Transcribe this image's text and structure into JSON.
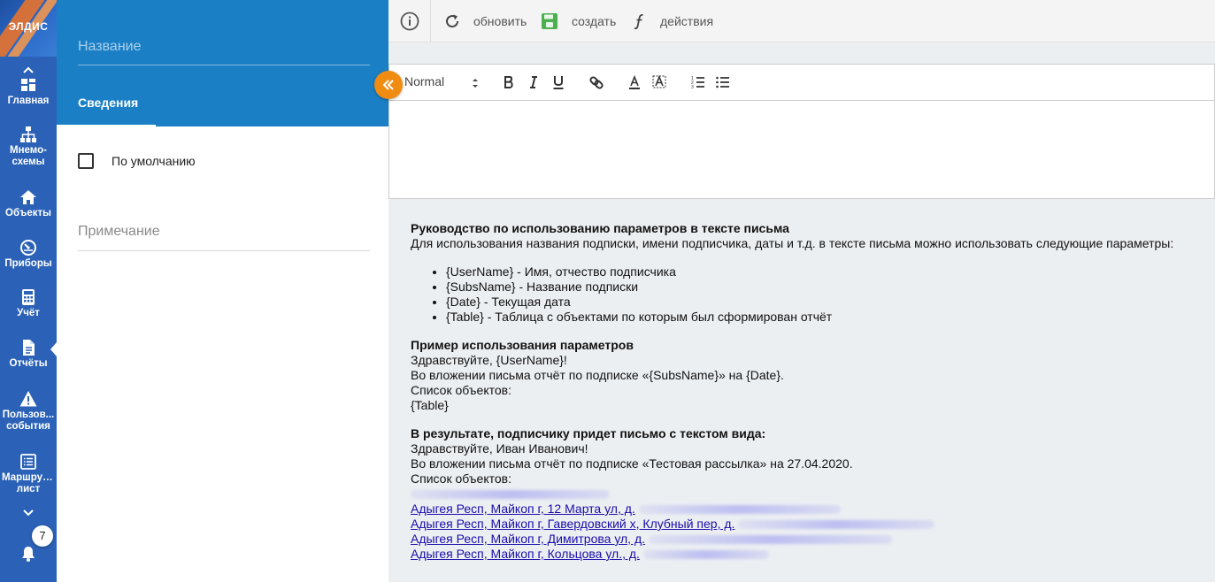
{
  "brand": {
    "logo_text": "ЭЛДИС"
  },
  "nav": {
    "items": [
      {
        "label": "Главная",
        "icon": "dashboard-icon"
      },
      {
        "label": "Мнемо-схемы",
        "label_line1": "Мнемо-",
        "label_line2": "схемы",
        "icon": "sitemap-icon"
      },
      {
        "label": "Объекты",
        "icon": "home-icon"
      },
      {
        "label": "Приборы",
        "icon": "gauge-icon"
      },
      {
        "label": "Учёт",
        "icon": "calculator-icon"
      },
      {
        "label": "Отчёты",
        "icon": "report-icon",
        "active": true
      },
      {
        "label_line1": "Пользов...",
        "label_line2": "события",
        "icon": "warning-icon"
      },
      {
        "label_line1": "Маршрут...",
        "label_line2": "лист",
        "icon": "list-icon"
      }
    ],
    "notifications_count": "7"
  },
  "form": {
    "title_placeholder": "Название",
    "tab_label": "Сведения",
    "default_checkbox_label": "По умолчанию",
    "default_checked": false,
    "note_placeholder": "Примечание"
  },
  "toolbar": {
    "refresh_label": "обновить",
    "create_label": "создать",
    "actions_label": "действия"
  },
  "editor": {
    "format_value": "Normal",
    "body_text": ""
  },
  "guide": {
    "heading": "Руководство по использованию параметров в тексте письма",
    "intro": "Для использования названия подписки, имени подписчика, даты и т.д. в тексте письма можно использовать следующие параметры:",
    "params": [
      "{UserName} - Имя, отчество подписчика",
      "{SubsName} - Название подписки",
      "{Date} - Текущая дата",
      "{Table} - Таблица с объектами по которым был сформирован отчёт"
    ],
    "example_heading": "Пример использования параметров",
    "example_lines": [
      "Здравствуйте, {UserName}!",
      "Во вложении письма отчёт по подписке «{SubsName}» на {Date}.",
      "Список объектов:",
      "{Table}"
    ],
    "result_heading": "В результате, подписчику придет письмо с текстом вида:",
    "result_lines": [
      "Здравствуйте, Иван Иванович!",
      "Во вложении письма отчёт по подписке «Тестовая рассылка» на 27.04.2020.",
      "Список объектов:"
    ],
    "links": [
      "Адыгея Респ, Майкоп г, 12 Марта ул, д.",
      "Адыгея Респ, Майкоп г, Гавердовский х, Клубный пер, д.",
      "Адыгея Респ, Майкоп г, Димитрова ул, д.",
      "Адыгея Респ, Майкоп г, Кольцова ул., д."
    ]
  },
  "colors": {
    "rail": "#2b62b8",
    "panel_header": "#1b7fc5",
    "accent_orange": "#f08c12",
    "save_green": "#4caf50",
    "content_bg": "#eceff2"
  }
}
